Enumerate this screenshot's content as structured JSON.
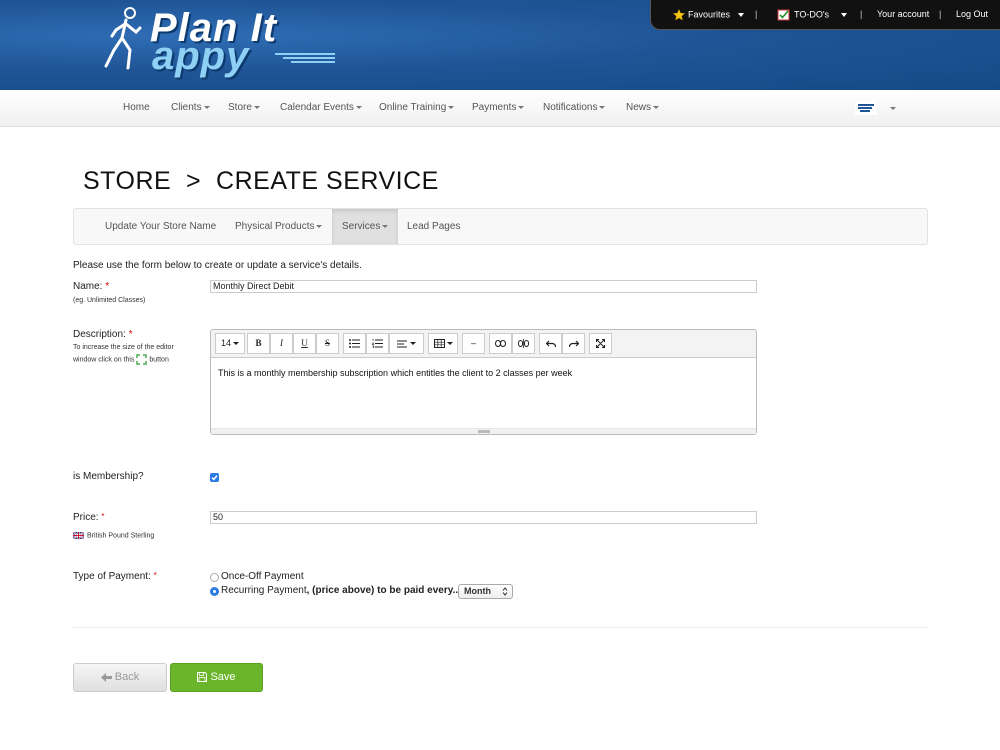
{
  "brand": {
    "line1": "Plan It",
    "line2": "appy"
  },
  "topbar": {
    "favourites": "Favourites",
    "todos": "TO-DO's",
    "account": "Your account",
    "logout": "Log Out"
  },
  "nav": {
    "items": [
      "Home",
      "Clients",
      "Store",
      "Calendar Events",
      "Online Training",
      "Payments",
      "Notifications",
      "News"
    ]
  },
  "page": {
    "title": "STORE  >  CREATE SERVICE"
  },
  "subnav": {
    "items": [
      "Update Your Store Name",
      "Physical Products",
      "Services",
      "Lead Pages"
    ],
    "active": "Services"
  },
  "form": {
    "intro": "Please use the form below to create or update a service's details.",
    "name_label": "Name:",
    "name_hint": "(eg. Unlimited Classes)",
    "name_value": "Monthly Direct Debit",
    "desc_label": "Description:",
    "desc_hint_1": "To increase the size of the editor",
    "desc_hint_2": "window click on this",
    "desc_hint_3": "button",
    "desc_value": "This is a monthly membership subscription which entitles the client to 2 classes per week",
    "font_size": "14",
    "membership_label": "is Membership?",
    "membership_checked": true,
    "price_label": "Price:",
    "price_value": "50",
    "currency": "British Pound Sterling",
    "payment_label": "Type of Payment:",
    "opt_once": "Once-Off Payment",
    "opt_recurring": "Recurring Payment",
    "opt_recurring_suffix": ", (price above) to be paid every..",
    "period": "Month"
  },
  "buttons": {
    "back": "Back",
    "save": "Save"
  },
  "colors": {
    "header": "#1f5596",
    "save": "#6bb52a",
    "required": "#dd0000",
    "accent": "#2a7be4"
  }
}
